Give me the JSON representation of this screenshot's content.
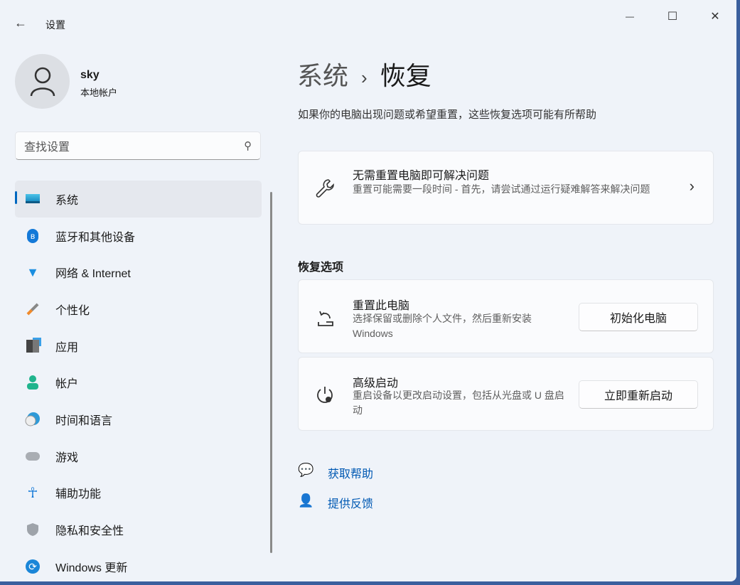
{
  "window": {
    "title": "设置",
    "back_icon": "arrow-left-icon",
    "minimize": "—",
    "maximize": "☐",
    "close": "✕"
  },
  "user": {
    "name": "sky",
    "type": "本地帐户"
  },
  "search": {
    "placeholder": "查找设置"
  },
  "nav": [
    {
      "label": "系统",
      "icon": "system-icon",
      "active": true
    },
    {
      "label": "蓝牙和其他设备",
      "icon": "bluetooth-icon"
    },
    {
      "label": "网络 & Internet",
      "icon": "wifi-icon"
    },
    {
      "label": "个性化",
      "icon": "brush-icon"
    },
    {
      "label": "应用",
      "icon": "apps-icon"
    },
    {
      "label": "帐户",
      "icon": "account-icon"
    },
    {
      "label": "时间和语言",
      "icon": "time-language-icon"
    },
    {
      "label": "游戏",
      "icon": "gamepad-icon"
    },
    {
      "label": "辅助功能",
      "icon": "accessibility-icon"
    },
    {
      "label": "隐私和安全性",
      "icon": "shield-icon"
    },
    {
      "label": "Windows 更新",
      "icon": "update-icon"
    }
  ],
  "breadcrumb": {
    "parent": "系统",
    "sep": "›",
    "current": "恢复"
  },
  "description": "如果你的电脑出现问题或希望重置，这些恢复选项可能有所帮助",
  "fix_card": {
    "title": "无需重置电脑即可解决问题",
    "subtitle": "重置可能需要一段时间 - 首先，请尝试通过运行疑难解答来解决问题",
    "chevron": "›"
  },
  "section_title": "恢复选项",
  "reset_card": {
    "title": "重置此电脑",
    "subtitle": "选择保留或删除个人文件，然后重新安装 Windows",
    "button": "初始化电脑"
  },
  "advanced_card": {
    "title": "高级启动",
    "subtitle": "重启设备以更改启动设置，包括从光盘或 U 盘启动",
    "button": "立即重新启动"
  },
  "links": {
    "help": "获取帮助",
    "feedback": "提供反馈"
  },
  "colors": {
    "accent": "#0067c0",
    "link": "#0059b3"
  }
}
